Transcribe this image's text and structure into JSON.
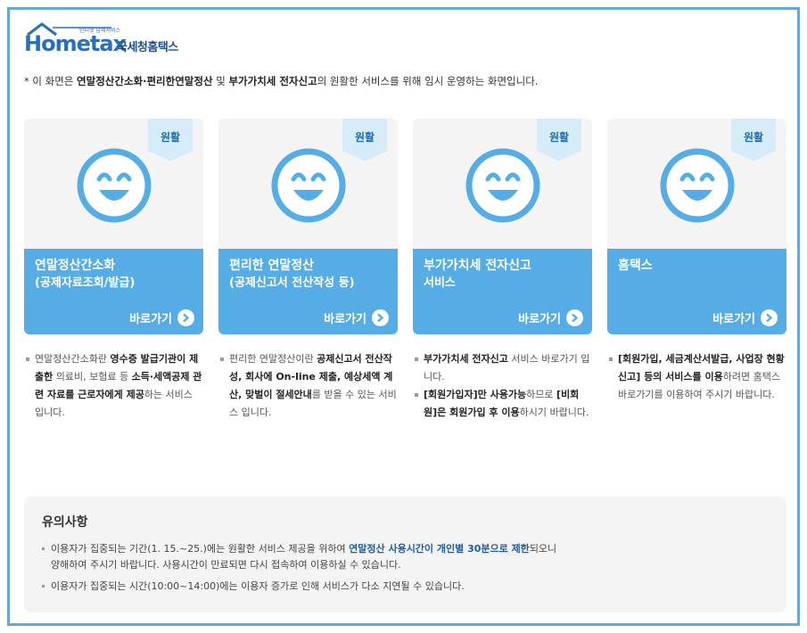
{
  "brand": {
    "logo_main": "Hometax",
    "logo_sub": "인터넷 납세서비스",
    "logo_kor": "국세청홈택스"
  },
  "notice": {
    "prefix": "* 이 화면은 ",
    "bold1": "연말정산간소화·편리한연말정산",
    "mid": " 및 ",
    "bold2": "부가가치세 전자신고",
    "suffix": "의 원활한 서비스를 위해 임시 운영하는 화면입니다."
  },
  "cards": [
    {
      "status": "원활",
      "title": "연말정산간소화",
      "subtitle": "(공제자료조회/발급)",
      "go_label": "바로가기"
    },
    {
      "status": "원활",
      "title": "편리한 연말정산",
      "subtitle": "(공제신고서 전산작성 등)",
      "go_label": "바로가기"
    },
    {
      "status": "원활",
      "title": "부가가치세 전자신고",
      "subtitle": "서비스",
      "go_label": "바로가기"
    },
    {
      "status": "원활",
      "title": "홈택스",
      "subtitle": "",
      "go_label": "바로가기"
    }
  ],
  "descriptions": {
    "d1": {
      "t1": "연말정산간소화란 ",
      "b1": "영수증 발급기관이 제출한",
      "t2": " 의료비, 보험료 등 ",
      "b2": "소득·세액공제 관련 자료를 근로자에게 제공",
      "t3": "하는 서비스 입니다."
    },
    "d2": {
      "t1": "편리한 연말정산이란 ",
      "b1": "공제신고서 전산작성, 회사에 On-line 제출, 예상세액 계산, 맞벌이 절세안내",
      "t2": "를 받을 수 있는 서비스 입니다."
    },
    "d3": {
      "i1_b1": "부가가치세 전자신고",
      "i1_t1": " 서비스 바로가기 입니다.",
      "i2_b1": "[회원가입자]만 사용가능",
      "i2_t1": "하므로 ",
      "i2_b2": "[비회원]은 회원가입 후 이용",
      "i2_t2": "하시기 바랍니다."
    },
    "d4": {
      "b1": "[회원가입, 세금계산서발급, 사업장 현황 신고] 등의 서비스를 이용",
      "t1": "하려면 홈택스 바로가기를 이용하여 주시기 바랍니다."
    }
  },
  "notes": {
    "title": "유의사항",
    "n1_t1": "이용자가 집중되는 기간(1. 15.~25.)에는 원활한 서비스 제공을 위하여 ",
    "n1_hl": "연말정산 사용시간이 개인별 30분으로 제한",
    "n1_t2": "되오니",
    "n1_line2": "양해하여 주시기 바랍니다. 사용시간이 만료되면 다시 접속하여 이용하실 수 있습니다.",
    "n2": "이용자가 집중되는 시간(10:00~14:00)에는 이용자 증가로 인해 서비스가 다소 지연될 수 있습니다."
  },
  "colors": {
    "accent": "#56ade6",
    "frame": "#6aa7d6",
    "badge": "#d6ecf9",
    "face": "#56ade6",
    "highlight": "#1b5fa6"
  }
}
